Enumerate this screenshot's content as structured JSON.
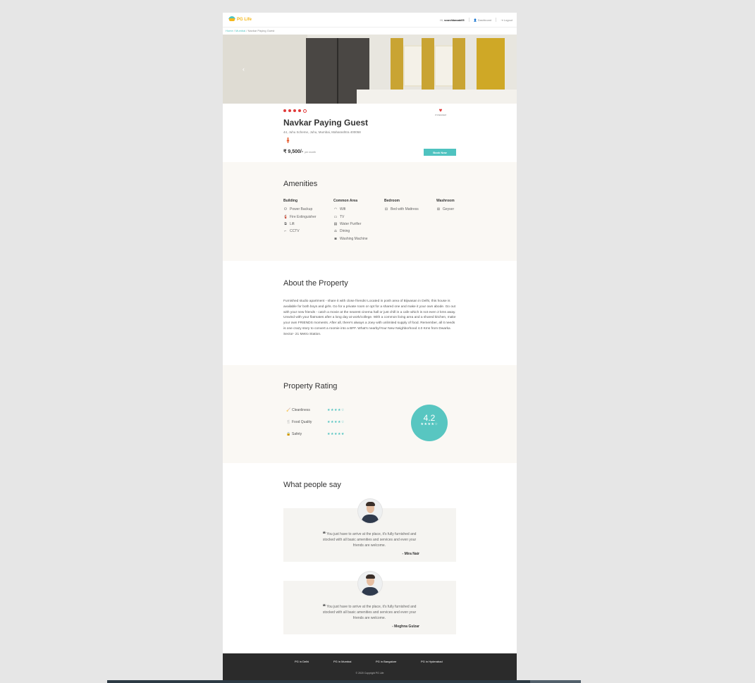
{
  "header": {
    "logo_text": "PG Life",
    "greeting": "Hi,",
    "username": "souvikbasak05",
    "dashboard_label": "Dashboard",
    "logout_label": "Logout"
  },
  "breadcrumb": {
    "home": "Home",
    "city": "Mumbai",
    "current": "Navkar Paying Guest"
  },
  "property": {
    "rating_dots": 4,
    "rating_dots_max": 5,
    "name": "Navkar Paying Guest",
    "address": "44, Juhu Scheme, Juhu, Mumbai, Maharashtra 400058",
    "price": "₹ 9,500/-",
    "price_unit": "per month",
    "interested_label": "2 interested",
    "book_label": "Book Now"
  },
  "amenities": {
    "title": "Amenities",
    "groups": [
      {
        "name": "Building",
        "items": [
          "Power Backup",
          "Fire Extinguisher",
          "Lift",
          "CCTV"
        ]
      },
      {
        "name": "Common Area",
        "items": [
          "Wifi",
          "TV",
          "Water Purifier",
          "Dining",
          "Washing Machine"
        ]
      },
      {
        "name": "Bedroom",
        "items": [
          "Bed with Mattress"
        ]
      },
      {
        "name": "Washroom",
        "items": [
          "Geyser"
        ]
      }
    ]
  },
  "about": {
    "title": "About the Property",
    "text": "Furnished studio apartment - share it with close friends! Located in posh area of Bijwasan in Delhi, this house is available for both boys and girls. Go for a private room or opt for a shared one and make it your own abode. Go out with your new friends - catch a movie at the nearest cinema hall or just chill in a cafe which is not even 2 kms away. Unwind with your flatmates after a long day at work/college. With a common living area and a shared kitchen, make your own FRIENDS moments. After all, there's always a Joey with unlimited supply of food. Remember, all it needs is one crazy story to convert a roomie into a BFF. What's nearby/Your New Neighborhood 4.0 Kms from Dwarka Sector- 21 Metro Station."
  },
  "ratings": {
    "title": "Property Rating",
    "overall": "4.2",
    "overall_stars": 4.2,
    "items": [
      {
        "label": "Cleanliness",
        "stars": 4,
        "icon": "broom-icon"
      },
      {
        "label": "Food Quality",
        "stars": 4,
        "icon": "utensils-icon"
      },
      {
        "label": "Safety",
        "stars": 5,
        "icon": "lock-icon"
      }
    ]
  },
  "testimonials": {
    "title": "What people say",
    "items": [
      {
        "quote": "You just have to arrive at the place, it's fully furnished and stocked with all basic amenities and services and even your friends are welcome.",
        "author": "- Mira Nair"
      },
      {
        "quote": "You just have to arrive at the place, it's fully furnished and stocked with all basic amenities and services and even your friends are welcome.",
        "author": "- Meghna Gulzar"
      }
    ]
  },
  "footer": {
    "links": [
      "PG in Delhi",
      "PG in Mumbai",
      "PG in Bangalore",
      "PG in Hyderabad"
    ],
    "copyright": "© 2020 Copyright PG Life"
  }
}
